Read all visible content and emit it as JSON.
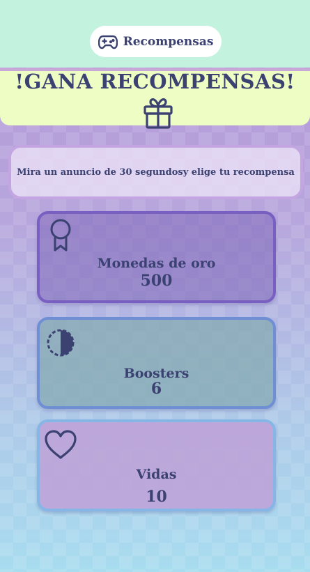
{
  "top_bar": {
    "tab_icon": "gamepad-icon",
    "tab_label": "Recompensas"
  },
  "header": {
    "title": "!GANA RECOMPENSAS!",
    "icon": "gift-icon"
  },
  "info": {
    "text": "Mira un anuncio de 30 segundosy elige tu recompensa"
  },
  "rewards": [
    {
      "icon": "ribbon-medal-icon",
      "label": "Monedas de oro",
      "value": "500"
    },
    {
      "icon": "half-circle-icon",
      "label": "Boosters",
      "value": "6"
    },
    {
      "icon": "heart-icon",
      "label": "Vidas",
      "value": "10"
    }
  ],
  "colors": {
    "top_bar_bg": "#c3f2de",
    "header_bg": "#eefdc3",
    "text": "#3b4170"
  }
}
